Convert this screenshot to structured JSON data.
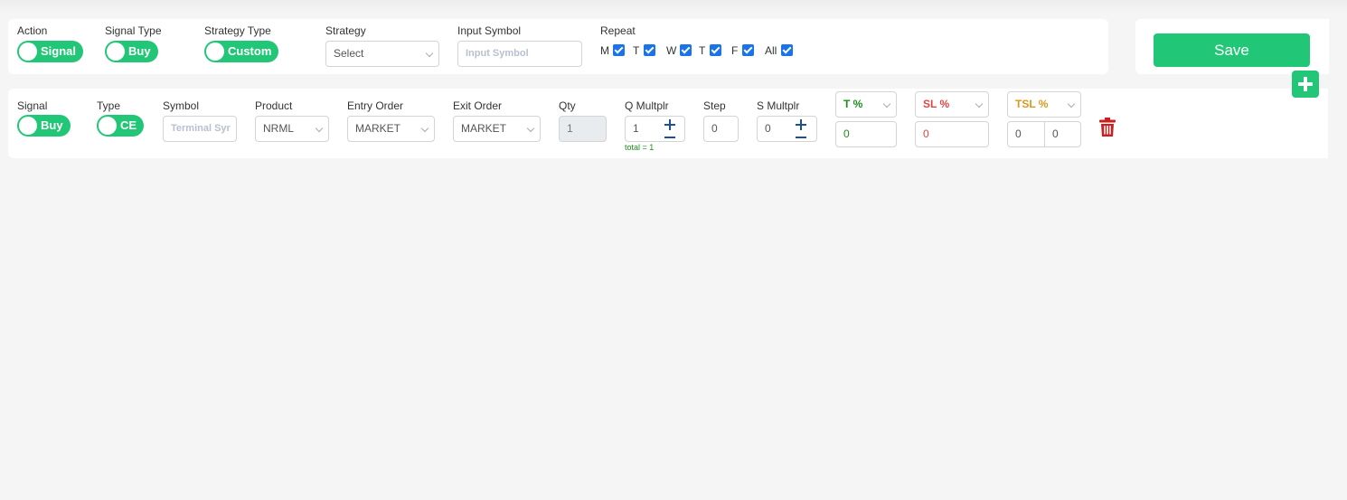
{
  "top": {
    "action": {
      "label": "Action",
      "value": "Signal"
    },
    "signal_type": {
      "label": "Signal Type",
      "value": "Buy"
    },
    "strategy_type": {
      "label": "Strategy Type",
      "value": "Custom"
    },
    "strategy": {
      "label": "Strategy",
      "value": "Select"
    },
    "input_symbol": {
      "label": "Input Symbol",
      "placeholder": "Input Symbol"
    },
    "repeat": {
      "label": "Repeat",
      "days": [
        {
          "label": "M",
          "checked": true
        },
        {
          "label": "T",
          "checked": true
        },
        {
          "label": "W",
          "checked": true
        },
        {
          "label": "T",
          "checked": true
        },
        {
          "label": "F",
          "checked": true
        },
        {
          "label": "All",
          "checked": true
        }
      ]
    }
  },
  "save": {
    "label": "Save"
  },
  "row": {
    "signal": {
      "label": "Signal",
      "value": "Buy"
    },
    "type": {
      "label": "Type",
      "value": "CE"
    },
    "symbol": {
      "label": "Symbol",
      "placeholder": "Terminal Syr"
    },
    "product": {
      "label": "Product",
      "value": "NRML"
    },
    "entry_order": {
      "label": "Entry Order",
      "value": "MARKET"
    },
    "exit_order": {
      "label": "Exit Order",
      "value": "MARKET"
    },
    "qty": {
      "label": "Qty",
      "value": "1"
    },
    "q_multiplier": {
      "label": "Q Multplr",
      "value": "1",
      "total": "total = 1"
    },
    "step": {
      "label": "Step",
      "value": "0"
    },
    "s_multiplier": {
      "label": "S Multplr",
      "value": "0"
    },
    "target": {
      "label": "T %",
      "value": "0"
    },
    "stoploss": {
      "label": "SL %",
      "value": "0"
    },
    "trailing_sl": {
      "label": "TSL %",
      "value_a": "0",
      "value_b": "0"
    }
  },
  "colors": {
    "accent": "#22c677",
    "target": "#1b8c1b",
    "stoploss": "#e04545",
    "trailing": "#d99a1a",
    "delete": "#cc1f1f",
    "stepper": "#1d4f91"
  },
  "icons": {
    "add": "plus-square-icon",
    "delete": "trash-icon"
  }
}
